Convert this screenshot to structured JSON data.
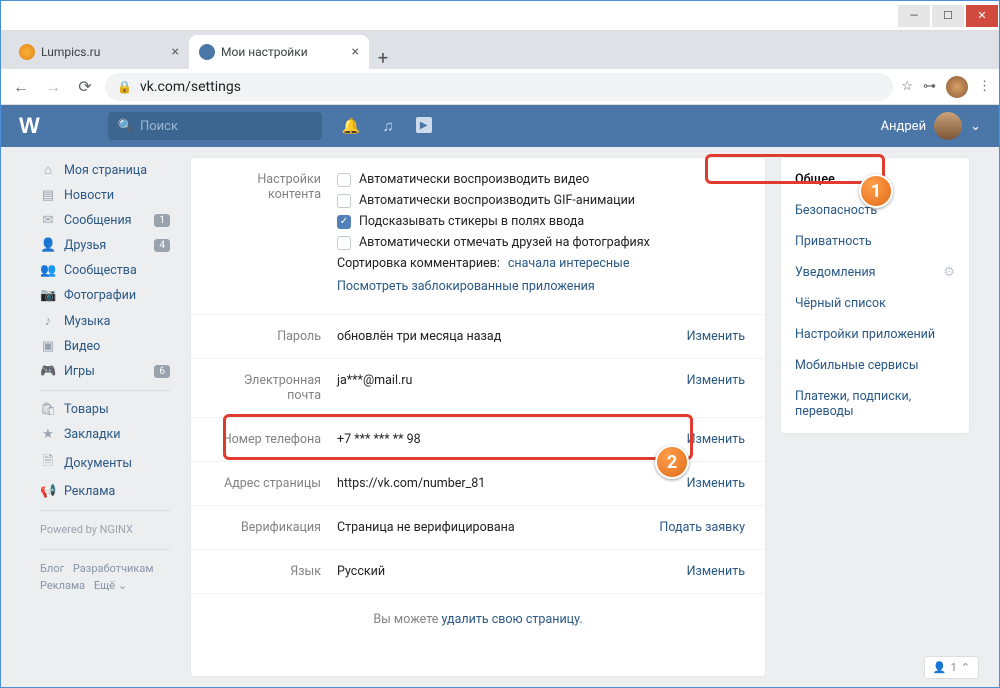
{
  "window": {
    "min": "—",
    "max": "☐",
    "close": "✕"
  },
  "tabs": {
    "t1": "Lumpics.ru",
    "t2": "Мои настройки",
    "newtab": "+"
  },
  "addr": {
    "back": "←",
    "fwd": "→",
    "reload": "⟳",
    "lock_text": "vk.com/settings",
    "star": "☆",
    "key": "⊶",
    "menu": "⋮"
  },
  "vk": {
    "logo": "W",
    "search_placeholder": "Поиск",
    "user_name": "Андрей",
    "bell": "🔔",
    "music": "♫",
    "play": "▶",
    "chev": "⌄"
  },
  "leftnav": {
    "items": [
      {
        "ic": "⌂",
        "label": "Моя страница"
      },
      {
        "ic": "▤",
        "label": "Новости"
      },
      {
        "ic": "✉",
        "label": "Сообщения",
        "badge": "1"
      },
      {
        "ic": "👤",
        "label": "Друзья",
        "badge": "4"
      },
      {
        "ic": "👥",
        "label": "Сообщества"
      },
      {
        "ic": "📷",
        "label": "Фотографии"
      },
      {
        "ic": "♪",
        "label": "Музыка"
      },
      {
        "ic": "▣",
        "label": "Видео"
      },
      {
        "ic": "🎮",
        "label": "Игры",
        "badge": "6"
      }
    ],
    "items2": [
      {
        "ic": "🛍",
        "label": "Товары"
      },
      {
        "ic": "★",
        "label": "Закладки"
      },
      {
        "ic": "🗎",
        "label": "Документы"
      },
      {
        "ic": "📢",
        "label": "Реклама"
      }
    ],
    "powered": "Powered by NGINX",
    "foot1a": "Блог",
    "foot1b": "Разработчикам",
    "foot2a": "Реклама",
    "foot2b": "Ещё ⌄"
  },
  "settings": {
    "content_label": "Настройки контента",
    "chk1": "Автоматически воспроизводить видео",
    "chk2": "Автоматически воспроизводить GIF-анимации",
    "chk3": "Подсказывать стикеры в полях ввода",
    "chk4": "Автоматически отмечать друзей на фотографиях",
    "sort_label": "Сортировка комментариев: ",
    "sort_value": "сначала интересные",
    "blocked_apps": "Посмотреть заблокированные приложения",
    "pass_label": "Пароль",
    "pass_value": "обновлён три месяца назад",
    "email_label": "Электронная почта",
    "email_value": "ja***@mail.ru",
    "phone_label": "Номер телефона",
    "phone_value": "+7 *** *** ** 98",
    "url_label": "Адрес страницы",
    "url_value": "https://vk.com/number_81",
    "verif_label": "Верификация",
    "verif_value": "Страница не верифицирована",
    "verif_action": "Подать заявку",
    "lang_label": "Язык",
    "lang_value": "Русский",
    "change": "Изменить",
    "delete_pre": "Вы можете ",
    "delete_link": "удалить свою страницу."
  },
  "rside": {
    "items": [
      "Общее",
      "Безопасность",
      "Приватность",
      "Уведомления",
      "Чёрный список",
      "Настройки приложений",
      "Мобильные сервисы",
      "Платежи, подписки, переводы"
    ],
    "gear": "⚙"
  },
  "float": {
    "text": "1",
    "ic": "👤",
    "chev": "⌃"
  },
  "anno": {
    "one": "1",
    "two": "2"
  }
}
